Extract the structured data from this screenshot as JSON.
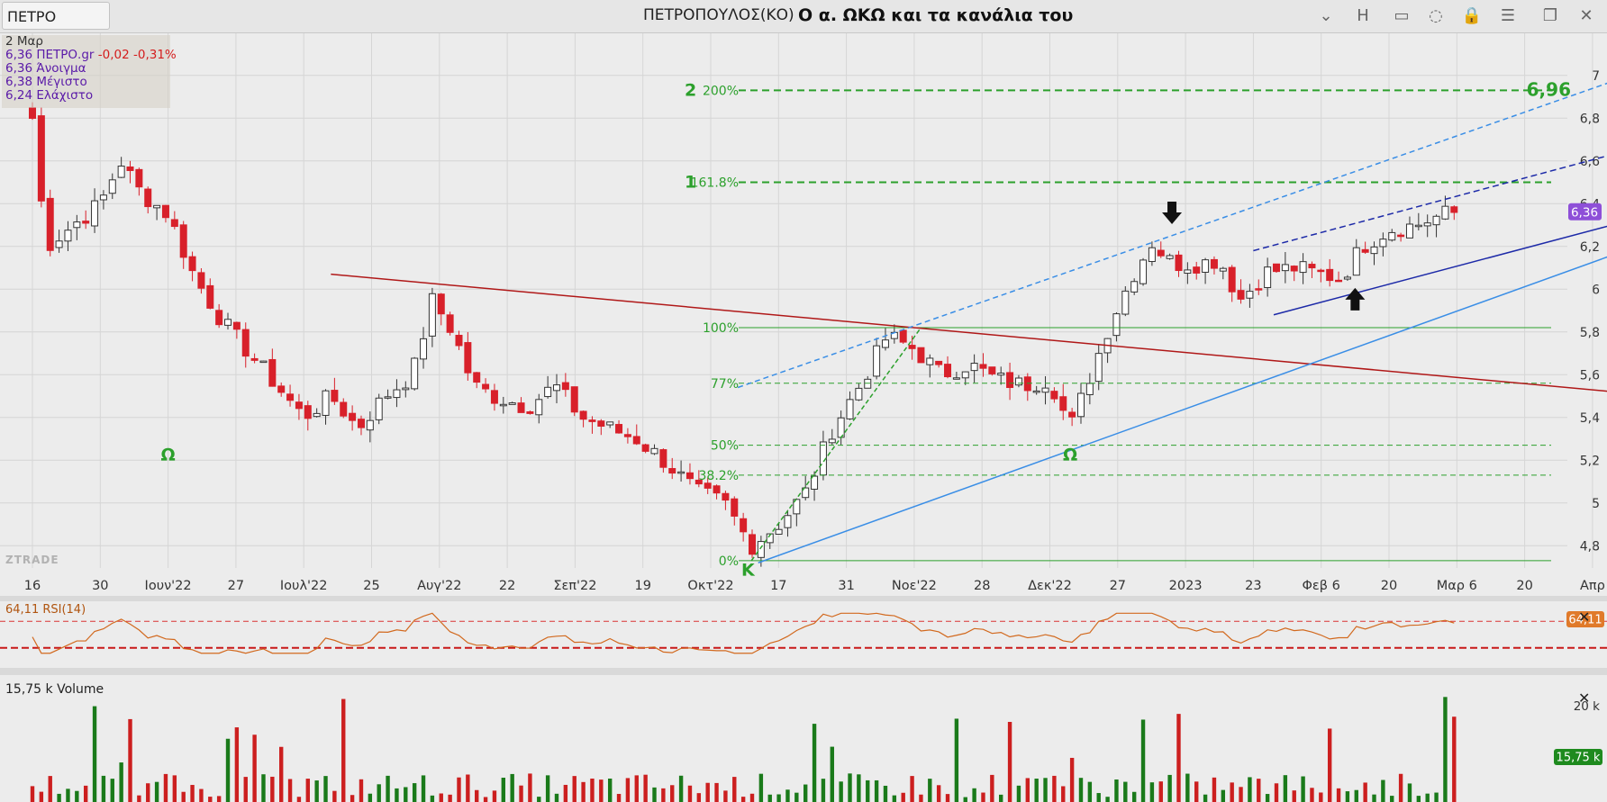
{
  "window": {
    "symbol": "ΠΕΤΡΟ",
    "instrument": "ΠΕΤΡΟΠΟΥΛΟΣ(ΚΟ)",
    "title": "Ο α. ΩΚΩ και τα κανάλια του",
    "toolbar": [
      {
        "name": "dropdown-icon",
        "glyph": "⌄"
      },
      {
        "name": "h-button",
        "glyph": "H"
      },
      {
        "name": "save-icon",
        "glyph": "▭"
      },
      {
        "name": "comment-icon",
        "glyph": "◌"
      },
      {
        "name": "lock-icon",
        "glyph": "🔒"
      },
      {
        "name": "menu-icon",
        "glyph": "☰"
      },
      {
        "name": "restore-icon",
        "glyph": "❐"
      },
      {
        "name": "close-icon",
        "glyph": "✕"
      }
    ]
  },
  "legend": {
    "date": "2 Μαρ",
    "close_line": "6,36 ΠΕΤΡΟ.gr",
    "change": "-0,02 -0,31%",
    "open": "6,36 Άνοιγμα",
    "high": "6,38 Μέγιστο",
    "low": "6,24 Ελάχιστο"
  },
  "brand": "ZTRADE",
  "colors": {
    "up": "#ffffff",
    "down": "#d8202a",
    "candle_outline": "#333333",
    "fib": "#2ca02c",
    "trend_red": "#b01818",
    "channel_light": "#3a8ee6",
    "channel_dark": "#1d2aa8",
    "rsi": "#d2691e",
    "volume_up": "#1a7a1a",
    "volume_down": "#cc1f1f",
    "last_price_badge": "#8e4fd8"
  },
  "chart_data": [
    {
      "type": "candlestick",
      "title": "Ο α. ΩΚΩ και τα κανάλια του",
      "y_ticks": [
        "7",
        "6,8",
        "6,6",
        "6,4",
        "6,2",
        "6",
        "5,8",
        "5,6",
        "5,4",
        "5,2",
        "5",
        "4,8"
      ],
      "x_ticks": [
        "16",
        "30",
        "Ιουν'22",
        "27",
        "Ιουλ'22",
        "25",
        "Αυγ'22",
        "22",
        "Σεπ'22",
        "19",
        "Οκτ'22",
        "17",
        "31",
        "Νοε'22",
        "28",
        "Δεκ'22",
        "27",
        "2023",
        "23",
        "Φεβ 6",
        "20",
        "Μαρ 6",
        "20",
        "Απρ"
      ],
      "ylim": [
        4.7,
        7.1
      ],
      "last_price": "6,36",
      "fib_levels": [
        {
          "label": "0%",
          "value": 4.73
        },
        {
          "label": "38.2%",
          "value": 5.13
        },
        {
          "label": "50%",
          "value": 5.27
        },
        {
          "label": "77%",
          "value": 5.56
        },
        {
          "label": "100%",
          "value": 5.82
        },
        {
          "label": "161.8%",
          "value": 6.5,
          "ext": "1"
        },
        {
          "label": "200%",
          "value": 6.93,
          "ext": "2"
        }
      ],
      "target_label": "6,96",
      "pattern_labels": [
        {
          "text": "Ω",
          "date_index": 2.0,
          "value": 5.2
        },
        {
          "text": "Κ",
          "date_index": 10.55,
          "value": 4.66
        },
        {
          "text": "Ω",
          "date_index": 15.3,
          "value": 5.2
        }
      ],
      "close_path": [
        [
          0.0,
          6.8
        ],
        [
          0.2,
          6.2
        ],
        [
          0.6,
          6.3
        ],
        [
          1.0,
          6.4
        ],
        [
          1.3,
          6.6
        ],
        [
          1.6,
          6.45
        ],
        [
          2.0,
          6.35
        ],
        [
          2.4,
          6.05
        ],
        [
          2.8,
          5.85
        ],
        [
          3.2,
          5.7
        ],
        [
          3.6,
          5.55
        ],
        [
          4.0,
          5.4
        ],
        [
          4.4,
          5.5
        ],
        [
          4.8,
          5.35
        ],
        [
          5.2,
          5.5
        ],
        [
          5.6,
          5.6
        ],
        [
          5.9,
          5.95
        ],
        [
          6.2,
          5.8
        ],
        [
          6.5,
          5.55
        ],
        [
          6.8,
          5.5
        ],
        [
          7.3,
          5.45
        ],
        [
          7.7,
          5.55
        ],
        [
          8.1,
          5.4
        ],
        [
          8.5,
          5.35
        ],
        [
          8.9,
          5.3
        ],
        [
          9.3,
          5.2
        ],
        [
          9.8,
          5.05
        ],
        [
          10.2,
          5.0
        ],
        [
          10.6,
          4.8
        ],
        [
          11.0,
          4.9
        ],
        [
          11.4,
          5.05
        ],
        [
          11.8,
          5.35
        ],
        [
          12.2,
          5.55
        ],
        [
          12.6,
          5.78
        ],
        [
          13.0,
          5.72
        ],
        [
          13.4,
          5.6
        ],
        [
          13.8,
          5.65
        ],
        [
          14.2,
          5.58
        ],
        [
          14.6,
          5.55
        ],
        [
          15.0,
          5.58
        ],
        [
          15.3,
          5.35
        ],
        [
          15.6,
          5.6
        ],
        [
          15.9,
          5.85
        ],
        [
          16.2,
          6.05
        ],
        [
          16.5,
          6.22
        ],
        [
          16.8,
          6.12
        ],
        [
          17.2,
          6.12
        ],
        [
          17.5,
          6.14
        ],
        [
          17.8,
          5.95
        ],
        [
          18.2,
          6.08
        ],
        [
          18.6,
          6.1
        ],
        [
          19.0,
          6.07
        ],
        [
          19.3,
          6.05
        ],
        [
          19.6,
          6.2
        ],
        [
          20.0,
          6.28
        ],
        [
          20.4,
          6.3
        ],
        [
          20.8,
          6.35
        ],
        [
          21.05,
          6.36
        ]
      ],
      "trendlines": [
        {
          "color": "trend_red",
          "dash": "",
          "from": [
            4.4,
            6.07
          ],
          "to": [
            24.0,
            5.5
          ]
        },
        {
          "color": "channel_light",
          "dash": "6,4",
          "from": [
            10.4,
            5.54
          ],
          "to": [
            24.0,
            7.05
          ]
        },
        {
          "color": "channel_light",
          "dash": "",
          "from": [
            10.7,
            4.72
          ],
          "to": [
            24.0,
            6.24
          ]
        },
        {
          "color": "channel_dark",
          "dash": "",
          "from": [
            18.3,
            5.88
          ],
          "to": [
            24.0,
            6.36
          ]
        },
        {
          "color": "channel_dark",
          "dash": "7,4",
          "from": [
            18.0,
            6.18
          ],
          "to": [
            24.0,
            6.69
          ]
        },
        {
          "color": "fib",
          "dash": "5,3",
          "from": [
            10.6,
            4.73
          ],
          "to": [
            13.1,
            5.82
          ]
        }
      ],
      "arrows": [
        {
          "direction": "down",
          "date_index": 16.8,
          "value": 6.3
        },
        {
          "direction": "up",
          "date_index": 19.5,
          "value": 6.01
        }
      ]
    },
    {
      "type": "line",
      "series": [
        {
          "name": "RSI(14)",
          "last": "64,11"
        }
      ],
      "label": "64,11 RSI(14)",
      "ylim": [
        0,
        100
      ],
      "overbought": 70,
      "oversold": 30
    },
    {
      "type": "bar",
      "series": [
        {
          "name": "Volume",
          "last": "15,75 k"
        }
      ],
      "label": "15,75 k Volume",
      "y_ticks": [
        "20 k"
      ],
      "last_label": "15,75 k"
    }
  ]
}
